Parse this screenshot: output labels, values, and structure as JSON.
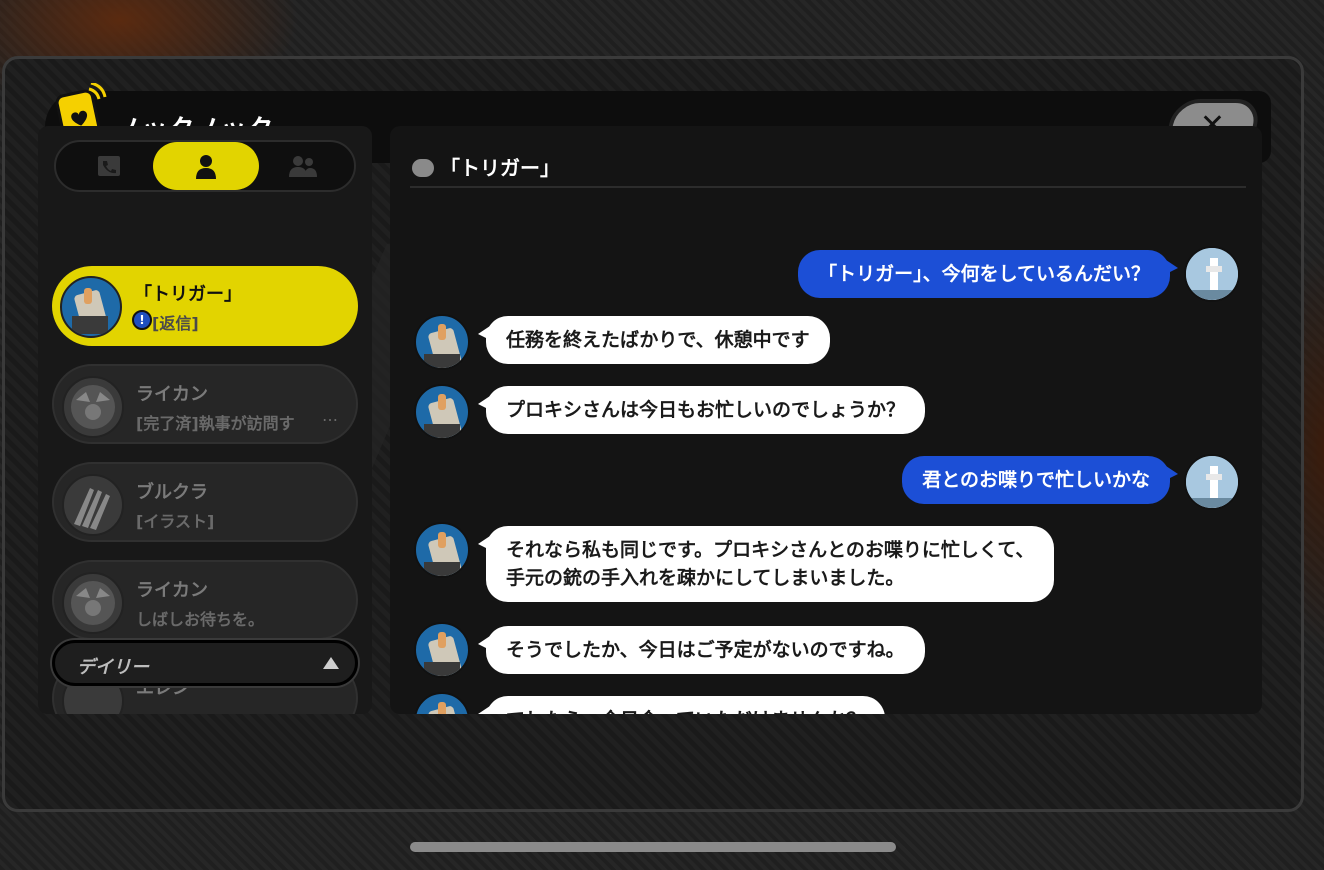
{
  "window": {
    "title": "ノックノック"
  },
  "tabs": [
    {
      "icon": "phone-contact-icon",
      "active": false
    },
    {
      "icon": "person-icon",
      "active": true
    },
    {
      "icon": "group-icon",
      "active": false
    }
  ],
  "contacts": [
    {
      "name": "「トリガー」",
      "message": "[返信]",
      "selected": true,
      "alert": "!"
    },
    {
      "name": "ライカン",
      "message": "[完了済]執事が訪問す",
      "more": "…",
      "selected": false
    },
    {
      "name": "ブルクラ",
      "message": "[イラスト]",
      "selected": false
    },
    {
      "name": "ライカン",
      "message": "しばしお待ちを。",
      "selected": false
    },
    {
      "name": "エレン",
      "message": "",
      "selected": false
    }
  ],
  "filter": {
    "label": "デイリー"
  },
  "chat": {
    "title": "「トリガー」",
    "messages": [
      {
        "from": "me",
        "text": "「トリガー」、今何をしているんだい？"
      },
      {
        "from": "npc",
        "text": "任務を終えたばかりで、休憩中です"
      },
      {
        "from": "npc",
        "text": "プロキシさんは今日もお忙しいのでしょうか？"
      },
      {
        "from": "me",
        "text": "君とのお喋りで忙しいかな"
      },
      {
        "from": "npc",
        "text": "それなら私も同じです。プロキシさんとのお喋りに忙しくて、",
        "text2": "手元の銃の手入れを疎かにしてしまいました。"
      },
      {
        "from": "npc",
        "text": "そうでしたか、今日はご予定がないのですね。"
      },
      {
        "from": "npc",
        "text": "でしたら…今日会っていただけませんか？"
      }
    ]
  },
  "colors": {
    "accent_yellow": "#e2d400",
    "player_bubble": "#1c4fd6",
    "npc_bubble": "#ffffff"
  }
}
